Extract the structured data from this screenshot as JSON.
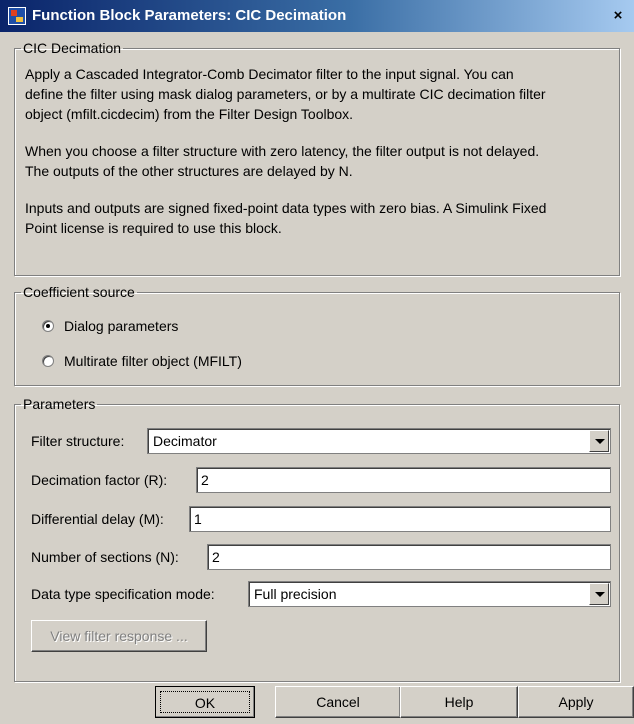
{
  "window": {
    "title": "Function Block Parameters: CIC Decimation",
    "close_glyph": "×"
  },
  "description": {
    "legend": "CIC Decimation",
    "lines": [
      "Apply a Cascaded Integrator-Comb Decimator filter to the input signal. You can",
      "define the filter using mask dialog parameters, or by a multirate CIC decimation filter",
      "object (mfilt.cicdecim) from the Filter Design Toolbox.",
      "When you choose a filter structure with zero latency, the filter output is not delayed.",
      "The outputs of the other structures are delayed by N.",
      "Inputs and outputs are signed fixed-point data types with zero bias.  A Simulink Fixed",
      "Point license is required to use this block."
    ]
  },
  "coefficient_source": {
    "legend": "Coefficient source",
    "options": [
      {
        "label": "Dialog parameters",
        "checked": true
      },
      {
        "label": "Multirate filter object (MFILT)",
        "checked": false
      }
    ]
  },
  "parameters": {
    "legend": "Parameters",
    "filter_structure": {
      "label": "Filter structure:",
      "value": "Decimator"
    },
    "decimation_factor": {
      "label": "Decimation factor (R):",
      "value": "2"
    },
    "differential_delay": {
      "label": "Differential delay (M):",
      "value": "1"
    },
    "number_of_sections": {
      "label": "Number of sections (N):",
      "value": "2"
    },
    "data_type_mode": {
      "label": "Data type specification mode:",
      "value": "Full precision"
    },
    "view_response_label": "View filter response ..."
  },
  "buttons": {
    "ok": "OK",
    "cancel": "Cancel",
    "help": "Help",
    "apply": "Apply"
  },
  "icons": {
    "app": "simulink-block-icon",
    "close": "close-icon",
    "dropdown": "chevron-down-icon"
  }
}
